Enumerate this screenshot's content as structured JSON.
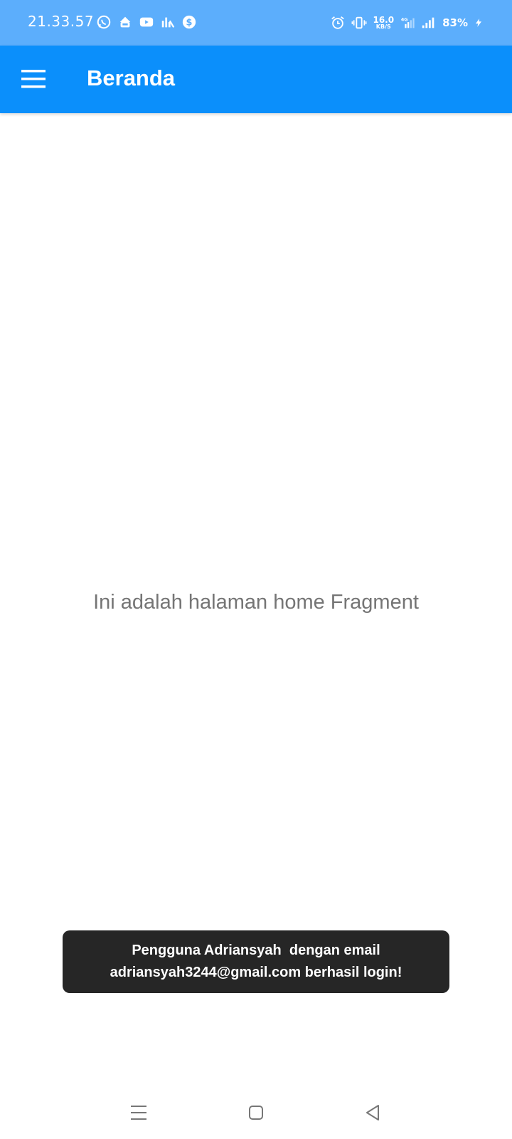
{
  "status_bar": {
    "time": "21.33.57",
    "left_icons": [
      "whatsapp-icon",
      "app-notification-icon",
      "youtube-icon",
      "stats-icon",
      "dollar-icon"
    ],
    "right_icons": [
      "alarm-icon",
      "vibrate-icon",
      "4g-signal-icon",
      "signal-icon",
      "charging-icon"
    ],
    "net_speed_value": "16.0",
    "net_speed_unit": "KB/S",
    "battery": "83%",
    "background_color": "#5caefc"
  },
  "app_bar": {
    "title": "Beranda",
    "menu_icon": "hamburger-menu-icon",
    "background_color": "#0b8ffb"
  },
  "content": {
    "message": "Ini adalah halaman home Fragment"
  },
  "toast": {
    "line1": "Pengguna Adriansyah  dengan email",
    "line2": "adriansyah3244@gmail.com berhasil login!"
  },
  "nav_bar": {
    "buttons": [
      "recent-apps-icon",
      "home-icon",
      "back-icon"
    ]
  }
}
